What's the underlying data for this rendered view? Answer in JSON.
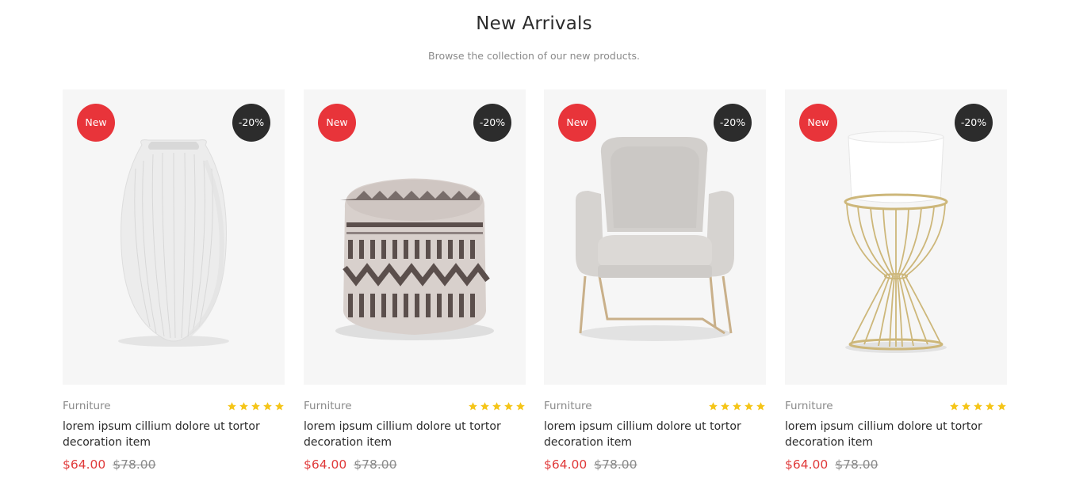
{
  "section": {
    "title": "New Arrivals",
    "subtitle": "Browse the collection of our new products."
  },
  "colors": {
    "new_badge": "#e8343a",
    "discount_badge": "#2c2c2c",
    "price": "#e03a3a",
    "star": "#f5c518",
    "card_background": "#f6f6f6"
  },
  "products": [
    {
      "badge_new": "New",
      "badge_discount": "-20%",
      "category": "Furniture",
      "rating": 5,
      "name": "lorem ipsum cillium dolore ut tortor decoration item",
      "price": "$64.00",
      "old_price": "$78.00",
      "image": "white-ceramic-vase"
    },
    {
      "badge_new": "New",
      "badge_discount": "-20%",
      "category": "Furniture",
      "rating": 5,
      "name": "lorem ipsum cillium dolore ut tortor decoration item",
      "price": "$64.00",
      "old_price": "$78.00",
      "image": "knitted-pouf"
    },
    {
      "badge_new": "New",
      "badge_discount": "-20%",
      "category": "Furniture",
      "rating": 5,
      "name": "lorem ipsum cillium dolore ut tortor decoration item",
      "price": "$64.00",
      "old_price": "$78.00",
      "image": "grey-armchair"
    },
    {
      "badge_new": "New",
      "badge_discount": "-20%",
      "category": "Furniture",
      "rating": 5,
      "name": "lorem ipsum cillium dolore ut tortor decoration item",
      "price": "$64.00",
      "old_price": "$78.00",
      "image": "planter-on-gold-stand"
    }
  ]
}
